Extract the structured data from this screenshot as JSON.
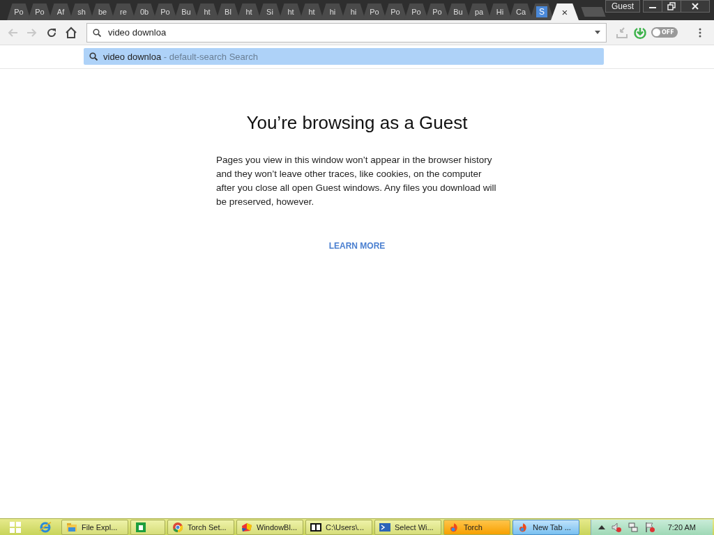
{
  "tabs": [
    {
      "title": "Po",
      "selected": false
    },
    {
      "title": "Po",
      "selected": false
    },
    {
      "title": "Af",
      "selected": false
    },
    {
      "title": "sh",
      "selected": false
    },
    {
      "title": "be",
      "selected": false
    },
    {
      "title": "re",
      "selected": false
    },
    {
      "title": "0b",
      "selected": false
    },
    {
      "title": "Po",
      "selected": false
    },
    {
      "title": "Bu",
      "selected": false
    },
    {
      "title": "ht",
      "selected": false
    },
    {
      "title": "Bl",
      "selected": false
    },
    {
      "title": "ht",
      "selected": false
    },
    {
      "title": "Si",
      "selected": false
    },
    {
      "title": "ht",
      "selected": false
    },
    {
      "title": "ht",
      "selected": false
    },
    {
      "title": "hi",
      "selected": false
    },
    {
      "title": "hi",
      "selected": false
    },
    {
      "title": "Po",
      "selected": false
    },
    {
      "title": "Po",
      "selected": false
    },
    {
      "title": "Po",
      "selected": false
    },
    {
      "title": "Po",
      "selected": false
    },
    {
      "title": "Bu",
      "selected": false
    },
    {
      "title": "pa",
      "selected": false
    },
    {
      "title": "Hi",
      "selected": false
    },
    {
      "title": "Ca",
      "selected": false
    },
    {
      "favicon": "S",
      "selected": false
    },
    {
      "close": "×",
      "selected": true
    }
  ],
  "profile_button": "Guest",
  "toolbar": {
    "back_disabled": true,
    "forward_disabled": true
  },
  "omnibox": {
    "value": "video downloa"
  },
  "suggestion": {
    "query": "video downloa",
    "detail": " - default-search Search",
    "selected": true
  },
  "extensions": {
    "toggle_label": "OFF",
    "toggle_on": false
  },
  "page": {
    "heading": "You’re browsing as a Guest",
    "body": "Pages you view in this window won’t appear in the browser history and they won’t leave other traces, like cookies, on the computer after you close all open Guest windows. Any files you download will be preserved, however.",
    "link": "LEARN MORE"
  },
  "taskbar": {
    "items": [
      {
        "kind": "folder",
        "label": "File Expl...",
        "selected": false,
        "flashing": false
      },
      {
        "kind": "store",
        "selected": false,
        "flashing": false
      },
      {
        "kind": "chrome",
        "label": "Torch Set...",
        "selected": false,
        "flashing": false
      },
      {
        "kind": "blinds",
        "label": "WindowBl...",
        "selected": false,
        "flashing": false
      },
      {
        "kind": "zip",
        "label": "C:\\Users\\...",
        "selected": false,
        "flashing": false
      },
      {
        "kind": "shell",
        "label": "Select Wi...",
        "selected": false,
        "flashing": false
      },
      {
        "kind": "torch",
        "label": "Torch",
        "selected": false,
        "flashing": true
      },
      {
        "kind": "torch",
        "label": "New Tab ...",
        "selected": true,
        "flashing": false
      }
    ],
    "clock": "7:20 AM"
  }
}
